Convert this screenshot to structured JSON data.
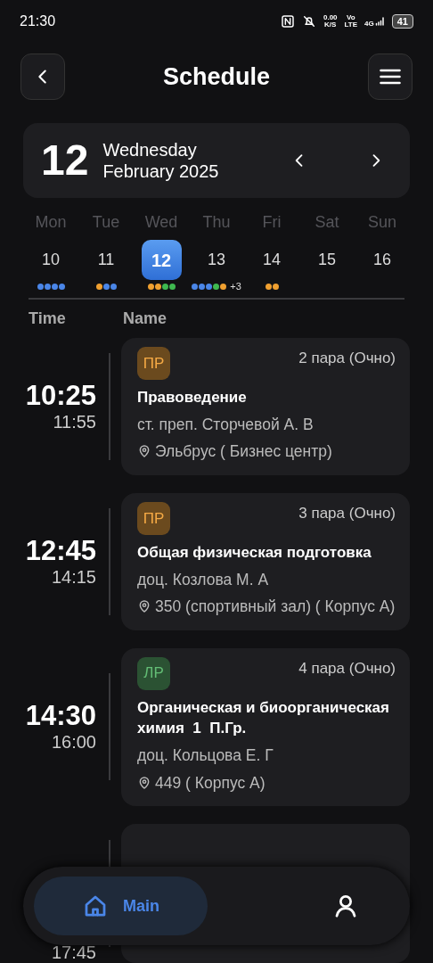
{
  "status_bar": {
    "time": "21:30",
    "net_speed": "0.00",
    "net_unit": "K/S",
    "volte_top": "Vo",
    "volte_bottom": "LTE",
    "network": "4G",
    "battery": "41"
  },
  "header": {
    "title": "Schedule"
  },
  "date_card": {
    "day": "12",
    "weekday": "Wednesday",
    "month_year": "February 2025"
  },
  "week": [
    {
      "weekday": "Mon",
      "date": "10",
      "selected": false,
      "dots": [
        {
          "color": "#4a86e8"
        },
        {
          "color": "#4a86e8"
        },
        {
          "color": "#4a86e8"
        },
        {
          "color": "#4a86e8"
        }
      ]
    },
    {
      "weekday": "Tue",
      "date": "11",
      "selected": false,
      "dots": [
        {
          "color": "#f0a030"
        },
        {
          "color": "#4a86e8"
        },
        {
          "color": "#4a86e8"
        }
      ]
    },
    {
      "weekday": "Wed",
      "date": "12",
      "selected": true,
      "dots": [
        {
          "color": "#f0a030"
        },
        {
          "color": "#f0a030"
        },
        {
          "color": "#3fb950"
        },
        {
          "color": "#3fb950"
        }
      ]
    },
    {
      "weekday": "Thu",
      "date": "13",
      "selected": false,
      "dots": [
        {
          "color": "#4a86e8"
        },
        {
          "color": "#4a86e8"
        },
        {
          "color": "#4a86e8"
        },
        {
          "color": "#3fb950"
        },
        {
          "color": "#f0a030"
        }
      ],
      "more": "+3"
    },
    {
      "weekday": "Fri",
      "date": "14",
      "selected": false,
      "dots": [
        {
          "color": "#f0a030"
        },
        {
          "color": "#f0a030"
        }
      ]
    },
    {
      "weekday": "Sat",
      "date": "15",
      "selected": false
    },
    {
      "weekday": "Sun",
      "date": "16",
      "selected": false
    }
  ],
  "columns": [
    "Time",
    "Name"
  ],
  "lessons": [
    {
      "start": "10:25",
      "end": "11:55",
      "type": "ПР",
      "color": "#6b4a1e",
      "pair": "2 пара (Очно)",
      "title": "Правоведение",
      "teacher": "ст. преп. Сторчевой А. В",
      "room": "Эльбрус ( Бизнес центр)"
    },
    {
      "start": "12:45",
      "end": "14:15",
      "type": "ПР",
      "color": "#6b4a1e",
      "pair": "3 пара (Очно)",
      "title": "Общая физическая подготовка",
      "teacher": "доц. Козлова М. А",
      "room": "350 (спортивный зал) ( Корпус А)"
    },
    {
      "start": "14:30",
      "end": "16:00",
      "type": "ЛР",
      "color": "#2b5233",
      "pair": "4 пара (Очно)",
      "title": "Органическая и биоорганическая химия  1  П.Гр.",
      "teacher": "доц. Кольцова Е. Г",
      "room": "449 ( Корпус А)"
    },
    {
      "end": "17:45"
    }
  ],
  "bottom_nav": [
    {
      "kind": "home",
      "label": "Main",
      "selected": true
    },
    {
      "kind": "profile",
      "selected": false
    }
  ]
}
